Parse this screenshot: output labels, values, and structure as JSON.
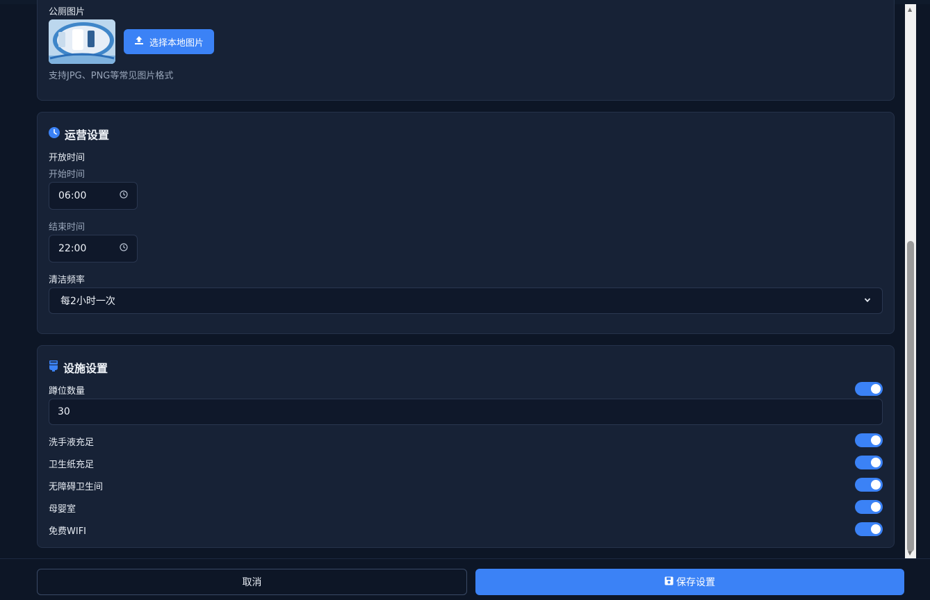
{
  "image_section": {
    "label": "公厕图片",
    "upload_button": "选择本地图片",
    "hint": "支持JPG、PNG等常见图片格式"
  },
  "operation": {
    "title": "运营设置",
    "hours_label": "开放时间",
    "start_label": "开始时间",
    "start_value": "06:00",
    "end_label": "结束时间",
    "end_value": "22:00",
    "frequency_label": "清洁频率",
    "frequency_value": "每2小时一次"
  },
  "facilities": {
    "title": "设施设置",
    "stalls_label": "蹲位数量",
    "stalls_value": "30",
    "stalls_toggle_on": true,
    "items": [
      {
        "label": "洗手液充足",
        "on": true
      },
      {
        "label": "卫生纸充足",
        "on": true
      },
      {
        "label": "无障碍卫生间",
        "on": true
      },
      {
        "label": "母婴室",
        "on": true
      },
      {
        "label": "免费WIFI",
        "on": true
      }
    ]
  },
  "footer": {
    "cancel": "取消",
    "save": "保存设置"
  },
  "colors": {
    "accent": "#3b82f6",
    "background": "#0d1626",
    "card": "#172236"
  }
}
